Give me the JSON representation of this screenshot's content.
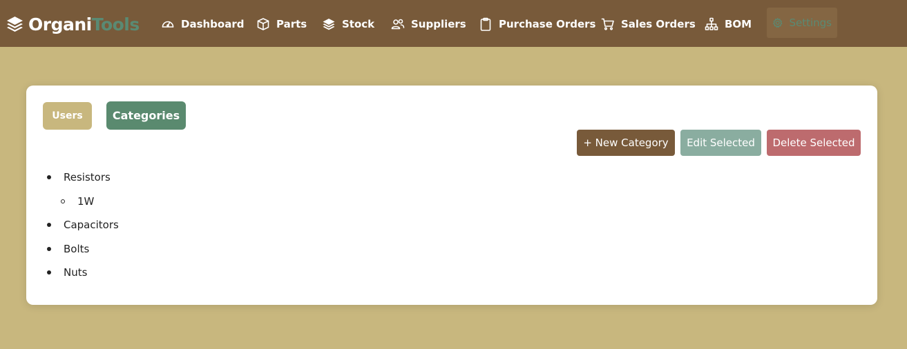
{
  "brand": {
    "part1": "Organi",
    "part2": "Tools"
  },
  "nav": {
    "dashboard": "Dashboard",
    "parts": "Parts",
    "stock": "Stock",
    "suppliers": "Suppliers",
    "purchase_orders": "Purchase Orders",
    "sales_orders": "Sales Orders",
    "bom": "BOM",
    "settings": "Settings"
  },
  "tabs": {
    "users": "Users",
    "categories": "Categories"
  },
  "actions": {
    "new_category": "+ New Category",
    "edit_selected": "Edit Selected",
    "delete_selected": "Delete Selected"
  },
  "categories": [
    {
      "name": "Resistors",
      "children": [
        {
          "name": "1W"
        }
      ]
    },
    {
      "name": "Capacitors",
      "children": []
    },
    {
      "name": "Bolts",
      "children": []
    },
    {
      "name": "Nuts",
      "children": []
    }
  ],
  "colors": {
    "navbar": "#785a3a",
    "background": "#c8b77e",
    "accent_green": "#5a8a6f",
    "edit": "#8aada0",
    "delete": "#bd6b6e"
  }
}
